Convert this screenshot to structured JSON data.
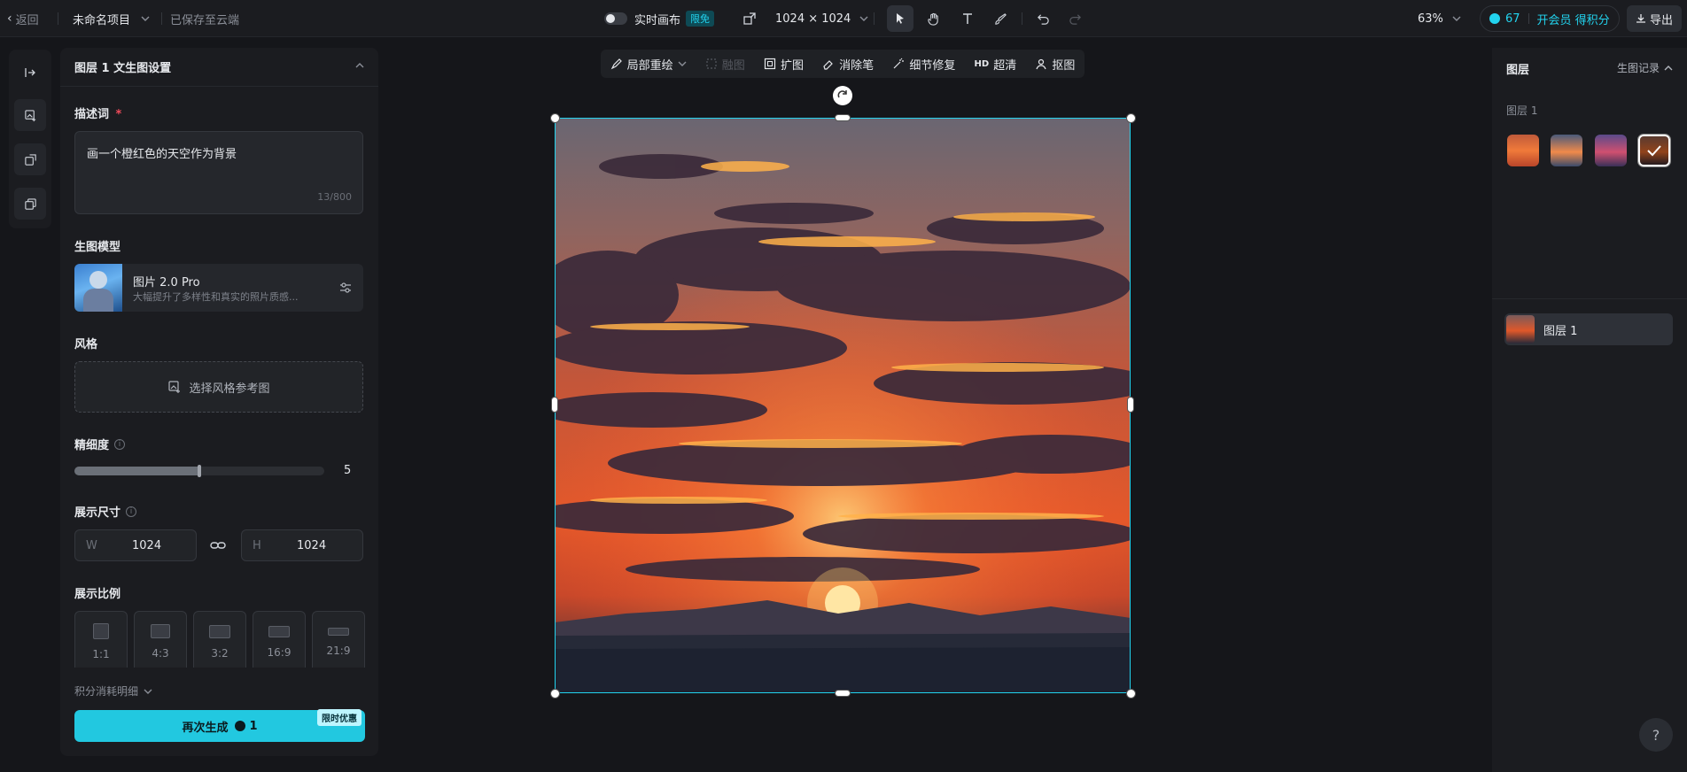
{
  "topbar": {
    "back_label": "返回",
    "project_name": "未命名项目",
    "save_status": "已保存至云端",
    "realtime_label": "实时画布",
    "realtime_badge": "限免",
    "canvas_size": "1024 × 1024",
    "zoom": "63%",
    "credits": "67",
    "member_label": "开会员 得积分",
    "export_label": "导出"
  },
  "left_panel": {
    "title": "图层 1 文生图设置",
    "prompt_label": "描述词",
    "prompt_required": "*",
    "prompt_value": "画一个橙红色的天空作为背景",
    "prompt_count": "13/800",
    "model_label": "生图模型",
    "model_name": "图片 2.0 Pro",
    "model_desc": "大幅提升了多样性和真实的照片质感...",
    "style_label": "风格",
    "style_button": "选择风格参考图",
    "detail_label": "精细度",
    "detail_value": "5",
    "detail_fraction": 0.5,
    "size_label": "展示尺寸",
    "width_prefix": "W",
    "width_value": "1024",
    "height_prefix": "H",
    "height_value": "1024",
    "ratio_label": "展示比例",
    "ratios": [
      "1:1",
      "4:3",
      "3:2",
      "16:9",
      "21:9"
    ],
    "credits_detail": "积分消耗明细",
    "regenerate_label": "再次生成",
    "regenerate_cost": "1",
    "promo_badge": "限时优惠"
  },
  "canvas_toolbar": {
    "inpaint": "局部重绘",
    "blend": "融图",
    "expand": "扩图",
    "eraser": "消除笔",
    "detail_fix": "细节修复",
    "hd_prefix": "HD",
    "upscale": "超清",
    "cutout": "抠图"
  },
  "right_panel": {
    "layers_title": "图层",
    "history_label": "生图记录",
    "group_label": "图层 1",
    "layer_item": "图层 1"
  },
  "colors": {
    "accent": "#22d3ee",
    "background": "#15161a",
    "panel": "#1b1c20"
  }
}
